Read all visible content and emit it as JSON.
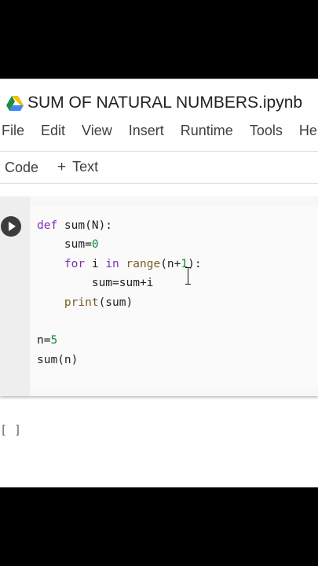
{
  "notebook": {
    "title": "SUM OF NATURAL NUMBERS.ipynb",
    "icon": "google-drive-icon"
  },
  "menu": {
    "items": [
      {
        "label": "File"
      },
      {
        "label": "Edit"
      },
      {
        "label": "View"
      },
      {
        "label": "Insert"
      },
      {
        "label": "Runtime"
      },
      {
        "label": "Tools"
      },
      {
        "label": "Help"
      }
    ]
  },
  "toolbar": {
    "code_label": "Code",
    "text_label": "Text",
    "text_icon": "+"
  },
  "cell": {
    "run_icon": "play-icon",
    "code": {
      "line1": {
        "kw": "def",
        "rest": " sum(N):"
      },
      "line2": {
        "indent": "    ",
        "lhs": "sum=",
        "num": "0"
      },
      "line3": {
        "indent": "    ",
        "kw1": "for",
        "mid": " i ",
        "kw2": "in",
        "sp": " ",
        "bi": "range",
        "args_open": "(n+",
        "num": "1",
        "args_close": "):"
      },
      "line4": {
        "indent": "        ",
        "text": "sum=sum+i"
      },
      "line5": {
        "indent": "    ",
        "bi": "print",
        "args": "(sum)"
      },
      "line7": {
        "lhs": "n=",
        "num": "5"
      },
      "line8": {
        "text": "sum(n)"
      }
    }
  },
  "output": {
    "prompt": "[ ]"
  },
  "colors": {
    "keyword": "#7b30b4",
    "builtin": "#795e26",
    "number": "#0b8a3d",
    "run_button": "#3c3c3c"
  }
}
